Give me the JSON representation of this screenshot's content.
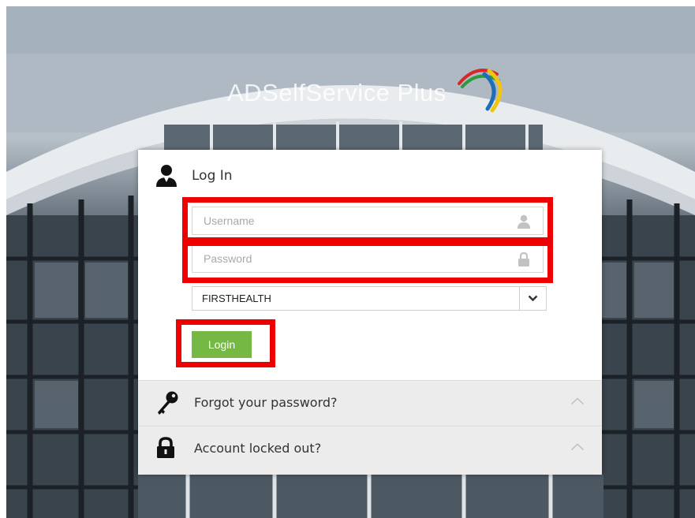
{
  "brand": {
    "name": "ADSelfService Plus"
  },
  "login_panel": {
    "title": "Log In",
    "username": {
      "placeholder": "Username",
      "value": ""
    },
    "password": {
      "placeholder": "Password",
      "value": ""
    },
    "domain_select": {
      "selected": "FIRSTHEALTH"
    },
    "login_button": "Login"
  },
  "accordion": [
    {
      "label": "Forgot your password?",
      "icon": "key-icon"
    },
    {
      "label": "Account locked out?",
      "icon": "lock-icon"
    }
  ],
  "colors": {
    "login_button": "#75b843",
    "highlight": "#ee0000"
  }
}
